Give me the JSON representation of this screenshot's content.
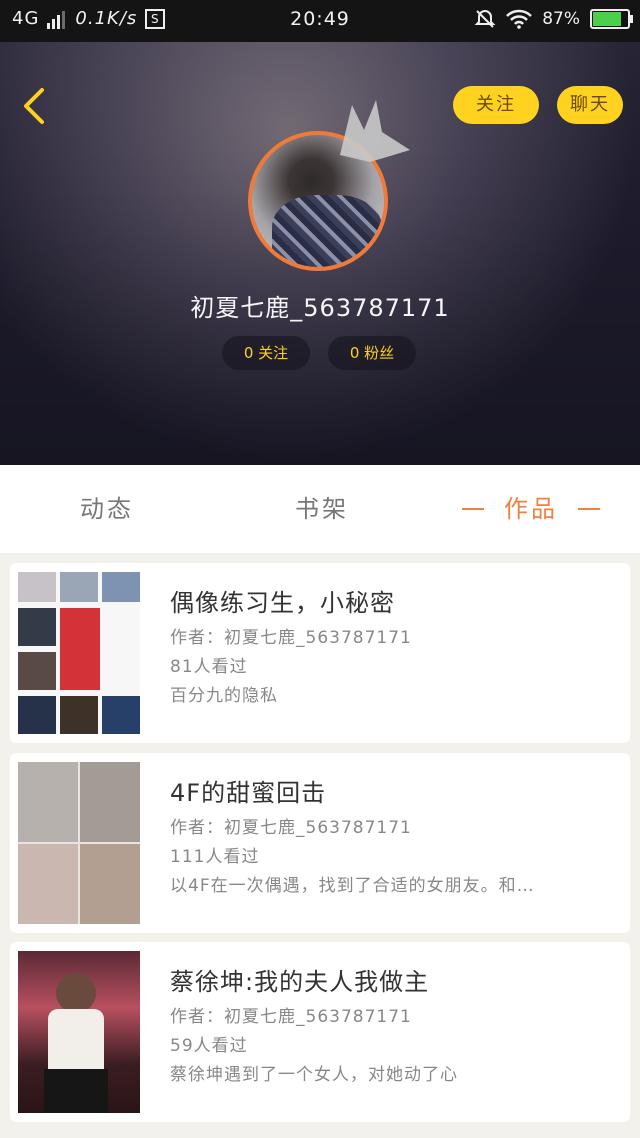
{
  "status_bar": {
    "network": "4G",
    "speed": "0.1K/s",
    "s_badge": "S",
    "time": "20:49",
    "battery": "87%",
    "battery_level": 0.87
  },
  "header": {
    "follow_button": "关注",
    "chat_button": "聊天",
    "username": "初夏七鹿_563787171",
    "following": "0 关注",
    "fans": "0 粉丝"
  },
  "tabs": [
    {
      "label": "动态"
    },
    {
      "label": "书架"
    },
    {
      "label": "作品"
    }
  ],
  "works": [
    {
      "title": "偶像练习生，小秘密",
      "author": "作者：初夏七鹿_563787171",
      "views": "81人看过",
      "summary": "百分九的隐私"
    },
    {
      "title": "4F的甜蜜回击",
      "author": "作者：初夏七鹿_563787171",
      "views": "111人看过",
      "summary": "以4F在一次偶遇，找到了合适的女朋友。和…"
    },
    {
      "title": "蔡徐坤:我的夫人我做主",
      "author": "作者：初夏七鹿_563787171",
      "views": "59人看过",
      "summary": "蔡徐坤遇到了一个女人，对她动了心"
    }
  ]
}
